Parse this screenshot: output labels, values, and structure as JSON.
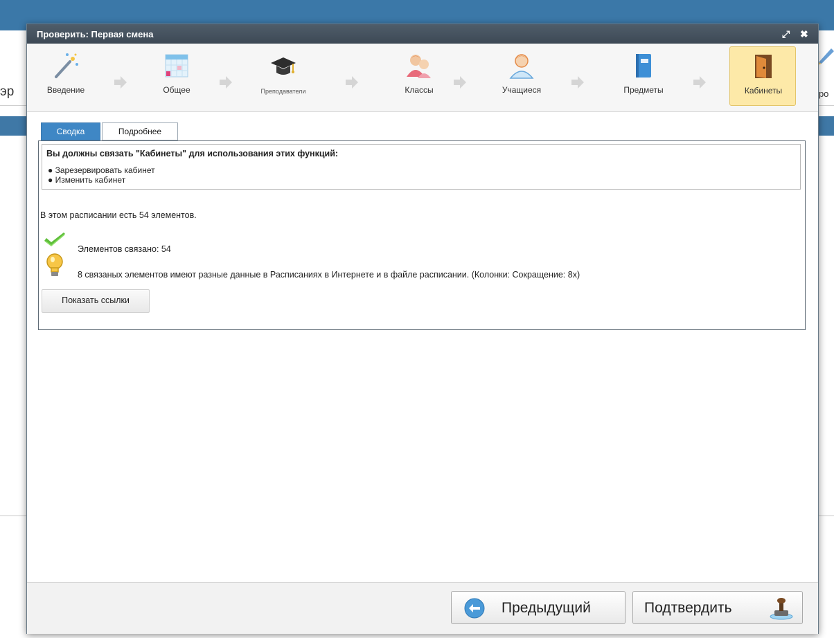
{
  "background": {
    "left_text": "эр",
    "right_text": "тро"
  },
  "dialog": {
    "title": "Проверить: Первая смена",
    "buttons": {
      "expand_icon": "⤢",
      "close_icon": "✖"
    }
  },
  "steps": [
    {
      "label": "Введение",
      "icon": "magic-wand-icon"
    },
    {
      "label": "Общее",
      "icon": "calendar-grid-icon"
    },
    {
      "label": "Преподаватели",
      "icon": "graduation-cap-icon"
    },
    {
      "label": "Классы",
      "icon": "students-group-icon"
    },
    {
      "label": "Учащиеся",
      "icon": "student-icon"
    },
    {
      "label": "Предметы",
      "icon": "book-icon"
    },
    {
      "label": "Кабинеты",
      "icon": "door-icon",
      "active": true
    }
  ],
  "tabs": [
    {
      "label": "Сводка",
      "active": true
    },
    {
      "label": "Подробнее",
      "active": false
    }
  ],
  "notice": {
    "title": "Вы должны связать \"Кабинеты\" для использования этих функций:",
    "items": [
      "● Зарезервировать кабинет",
      "● Изменить кабинет"
    ]
  },
  "summary": {
    "count_text": "В этом расписании есть 54 элементов.",
    "linked_text": "Элементов связано: 54",
    "diff_text": "8 связаных элементов имеют разные данные в Расписаниях в Интернете и в файле расписании. (Колонки: Сокращение: 8x)",
    "show_links_label": "Показать ссылки"
  },
  "footer": {
    "prev_label": "Предыдущий",
    "confirm_label": "Подтвердить"
  },
  "colors": {
    "titlebar": "#45525e",
    "tab_active": "#3f87c5",
    "step_active": "#fde9a8",
    "app_header": "#3b78a8"
  }
}
